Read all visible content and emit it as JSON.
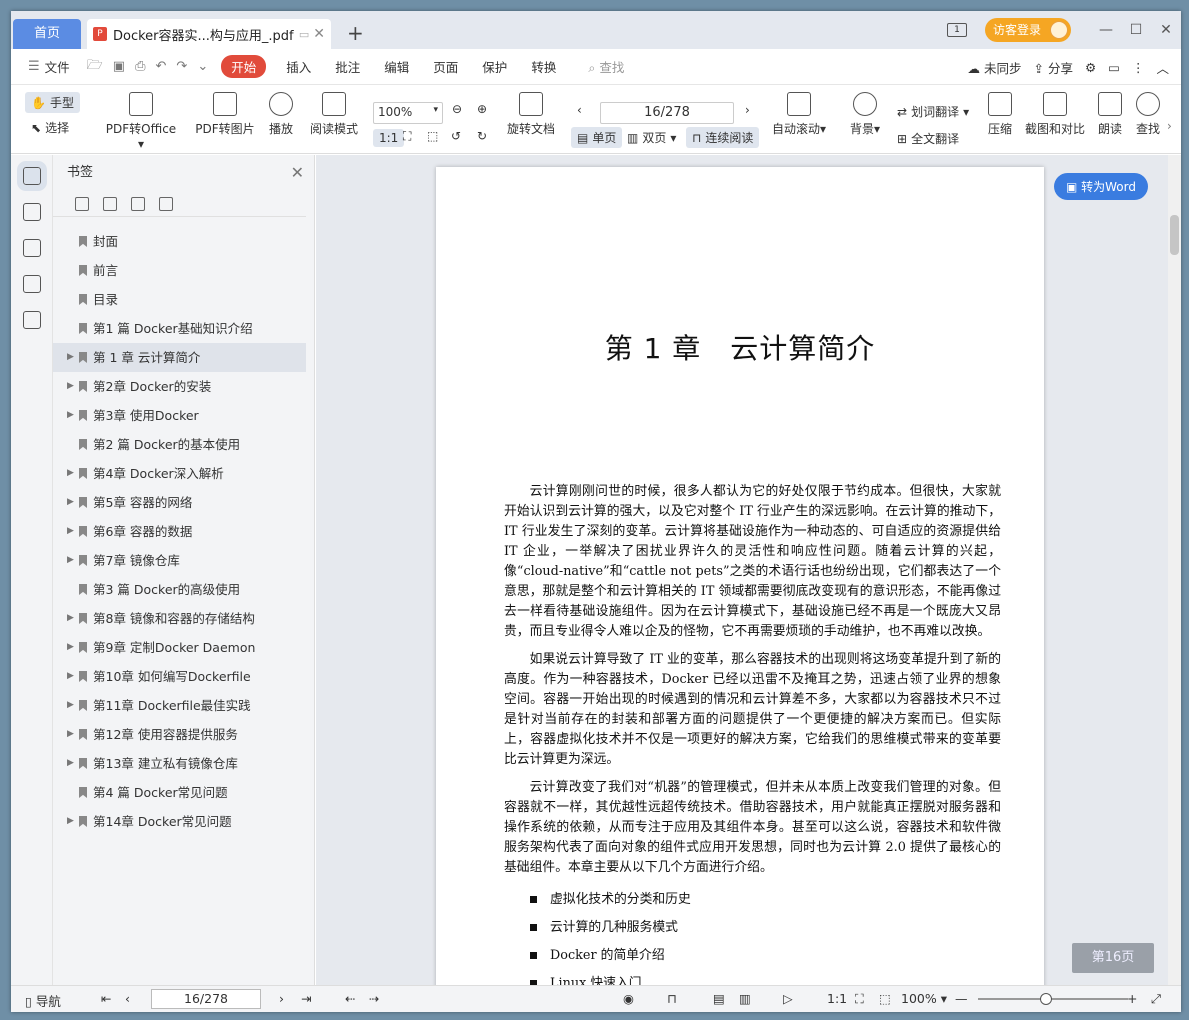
{
  "tabs": {
    "home": "首页",
    "doc": "Docker容器实...构与应用_.pdf",
    "new_tab": "+"
  },
  "titlebar": {
    "page_badge": "1",
    "login": "访客登录",
    "min": "—",
    "max": "☐",
    "close": "✕"
  },
  "menu": {
    "file": "文件",
    "items": [
      "开始",
      "插入",
      "批注",
      "编辑",
      "页面",
      "保护",
      "转换"
    ],
    "search": "查找",
    "sync": "未同步",
    "share": "分享"
  },
  "ribbon": {
    "hand": "手型",
    "select": "选择",
    "to_office": "PDF转Office",
    "to_image": "PDF转图片",
    "play": "播放",
    "read_mode": "阅读模式",
    "zoom": "100%",
    "rotate_doc": "旋转文档",
    "page_input": "16/278",
    "single": "单页",
    "double": "双页",
    "continuous": "连续阅读",
    "auto_scroll": "自动滚动",
    "background": "背景",
    "word_translate": "划词翻译",
    "full_translate": "全文翻译",
    "compress": "压缩",
    "screenshot": "截图和对比",
    "read_aloud": "朗读",
    "find": "查找"
  },
  "bookmarks": {
    "title": "书签",
    "items": [
      {
        "label": "封面",
        "arrow": ""
      },
      {
        "label": "前言",
        "arrow": ""
      },
      {
        "label": "目录",
        "arrow": ""
      },
      {
        "label": "第1 篇 Docker基础知识介绍",
        "arrow": ""
      },
      {
        "label": "第 1 章 云计算简介",
        "arrow": "▶",
        "selected": true
      },
      {
        "label": "第2章 Docker的安装",
        "arrow": "▶"
      },
      {
        "label": "第3章 使用Docker",
        "arrow": "▶"
      },
      {
        "label": "第2 篇 Docker的基本使用",
        "arrow": ""
      },
      {
        "label": "第4章 Docker深入解析",
        "arrow": "▶"
      },
      {
        "label": "第5章 容器的网络",
        "arrow": "▶"
      },
      {
        "label": "第6章 容器的数据",
        "arrow": "▶"
      },
      {
        "label": "第7章 镜像仓库",
        "arrow": "▶"
      },
      {
        "label": "第3 篇 Docker的高级使用",
        "arrow": ""
      },
      {
        "label": "第8章 镜像和容器的存储结构",
        "arrow": "▶"
      },
      {
        "label": "第9章 定制Docker Daemon",
        "arrow": "▶"
      },
      {
        "label": "第10章 如何编写Dockerfile",
        "arrow": "▶"
      },
      {
        "label": "第11章 Dockerfile最佳实践",
        "arrow": "▶"
      },
      {
        "label": "第12章 使用容器提供服务",
        "arrow": "▶"
      },
      {
        "label": "第13章 建立私有镜像仓库",
        "arrow": "▶"
      },
      {
        "label": "第4 篇 Docker常见问题",
        "arrow": ""
      },
      {
        "label": "第14章 Docker常见问题",
        "arrow": "▶"
      }
    ]
  },
  "page": {
    "chapter_title": "第 1 章　云计算简介",
    "p1": "云计算刚刚问世的时候，很多人都认为它的好处仅限于节约成本。但很快，大家就开始认识到云计算的强大，以及它对整个 IT 行业产生的深远影响。在云计算的推动下，IT 行业发生了深刻的变革。云计算将基础设施作为一种动态的、可自适应的资源提供给 IT 企业，一举解决了困扰业界许久的灵活性和响应性问题。随着云计算的兴起，像“cloud-native”和“cattle not pets”之类的术语行话也纷纷出现，它们都表达了一个意思，那就是整个和云计算相关的 IT 领域都需要彻底改变现有的意识形态，不能再像过去一样看待基础设施组件。因为在云计算模式下，基础设施已经不再是一个既庞大又昂贵，而且专业得令人难以企及的怪物，它不再需要烦琐的手动维护，也不再难以改换。",
    "p2": "如果说云计算导致了 IT 业的变革，那么容器技术的出现则将这场变革提升到了新的高度。作为一种容器技术，Docker 已经以迅雷不及掩耳之势，迅速占领了业界的想象空间。容器一开始出现的时候遇到的情况和云计算差不多，大家都以为容器技术只不过是针对当前存在的封装和部署方面的问题提供了一个更便捷的解决方案而已。但实际上，容器虚拟化技术并不仅是一项更好的解决方案，它给我们的思维模式带来的变革要比云计算更为深远。",
    "p3": "云计算改变了我们对“机器”的管理模式，但并未从本质上改变我们管理的对象。但容器就不一样，其优越性远超传统技术。借助容器技术，用户就能真正摆脱对服务器和操作系统的依赖，从而专注于应用及其组件本身。甚至可以这么说，容器技术和软件微服务架构代表了面向对象的组件式应用开发思想，同时也为云计算 2.0 提供了最核心的基础组件。本章主要从以下几个方面进行介绍。",
    "bullets": [
      "虚拟化技术的分类和历史",
      "云计算的几种服务模式",
      "Docker 的简单介绍",
      "Linux 快速入门"
    ],
    "to_word": "转为Word",
    "page_indicator": "第16页"
  },
  "status": {
    "nav": "导航",
    "page": "16/278",
    "zoom": "100%"
  }
}
